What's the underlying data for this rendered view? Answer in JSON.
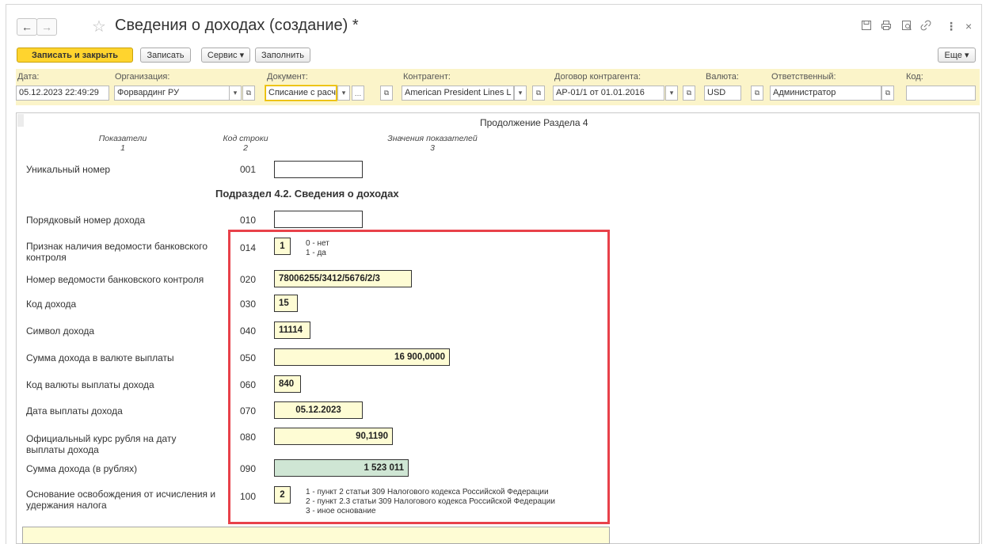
{
  "window": {
    "title": "Сведения о доходах (создание) *",
    "icons": [
      "save-icon",
      "print-icon",
      "preview-icon",
      "link-icon",
      "more-vert-icon",
      "close-icon"
    ]
  },
  "nav": {
    "back": "←",
    "forward": "→",
    "star": "☆"
  },
  "toolbar": {
    "save_close": "Записать и закрыть",
    "save": "Записать",
    "service": "Сервис ▾",
    "fill": "Заполнить",
    "more": "Еще ▾"
  },
  "header": {
    "date": {
      "label": "Дата:",
      "value": "05.12.2023 22:49:29"
    },
    "organization": {
      "label": "Организация:",
      "value": "Форвардинг РУ"
    },
    "document": {
      "label": "Документ:",
      "value": "Списание с расч"
    },
    "counterparty": {
      "label": "Контрагент:",
      "value": "American President Lines L"
    },
    "contract": {
      "label": "Договор контрагента:",
      "value": "AP-01/1 от 01.01.2016"
    },
    "currency": {
      "label": "Валюта:",
      "value": "USD"
    },
    "responsible": {
      "label": "Ответственный:",
      "value": "Администратор"
    },
    "code": {
      "label": "Код:",
      "value": ""
    }
  },
  "form": {
    "section_title": "Продолжение Раздела 4",
    "col1_title": "Показатели",
    "col1_num": "1",
    "col2_title": "Код строки",
    "col2_num": "2",
    "col3_title": "Значения показателей",
    "col3_num": "3",
    "subsection_title": "Подраздел 4.2. Сведения о доходах",
    "rows": {
      "unique": {
        "label": "Уникальный номер",
        "code": "001",
        "value": ""
      },
      "order": {
        "label": "Порядковый номер дохода",
        "code": "010",
        "value": ""
      },
      "bank_sign": {
        "label": "Признак наличия ведомости банковского контроля",
        "code": "014",
        "value": "1",
        "note1": "0 - нет",
        "note2": "1 - да"
      },
      "bank_number": {
        "label": "Номер ведомости банковского контроля",
        "code": "020",
        "value": "78006255/3412/5676/2/3"
      },
      "income_code": {
        "label": "Код дохода",
        "code": "030",
        "value": "15"
      },
      "income_symbol": {
        "label": "Символ дохода",
        "code": "040",
        "value": "11114"
      },
      "income_sum_cur": {
        "label": "Сумма дохода в валюте выплаты",
        "code": "050",
        "value": "16 900,0000"
      },
      "currency_code": {
        "label": "Код валюты выплаты дохода",
        "code": "060",
        "value": "840"
      },
      "pay_date": {
        "label": "Дата выплаты дохода",
        "code": "070",
        "value": "05.12.2023"
      },
      "rate": {
        "label": "Официальный курс рубля на дату выплаты дохода",
        "code": "080",
        "value": "90,1190"
      },
      "sum_rub": {
        "label": "Сумма дохода (в рублях)",
        "code": "090",
        "value": "1 523 011"
      },
      "exempt": {
        "label": "Основание освобождения от исчисления и удержания налога",
        "code": "100",
        "value": "2",
        "note1": "1 - пункт 2 статьи 309 Налогового кодекса Российской Федерации",
        "note2": "2 - пункт 2.3 статьи 309 Налогового кодекса Российской Федерации",
        "note3": "3 - иное основание"
      }
    }
  },
  "colors": {
    "accent": "#ffd42e",
    "highlight": "#e8414a",
    "field_yellow": "#fefcd4",
    "field_green": "#cfe6d4"
  }
}
